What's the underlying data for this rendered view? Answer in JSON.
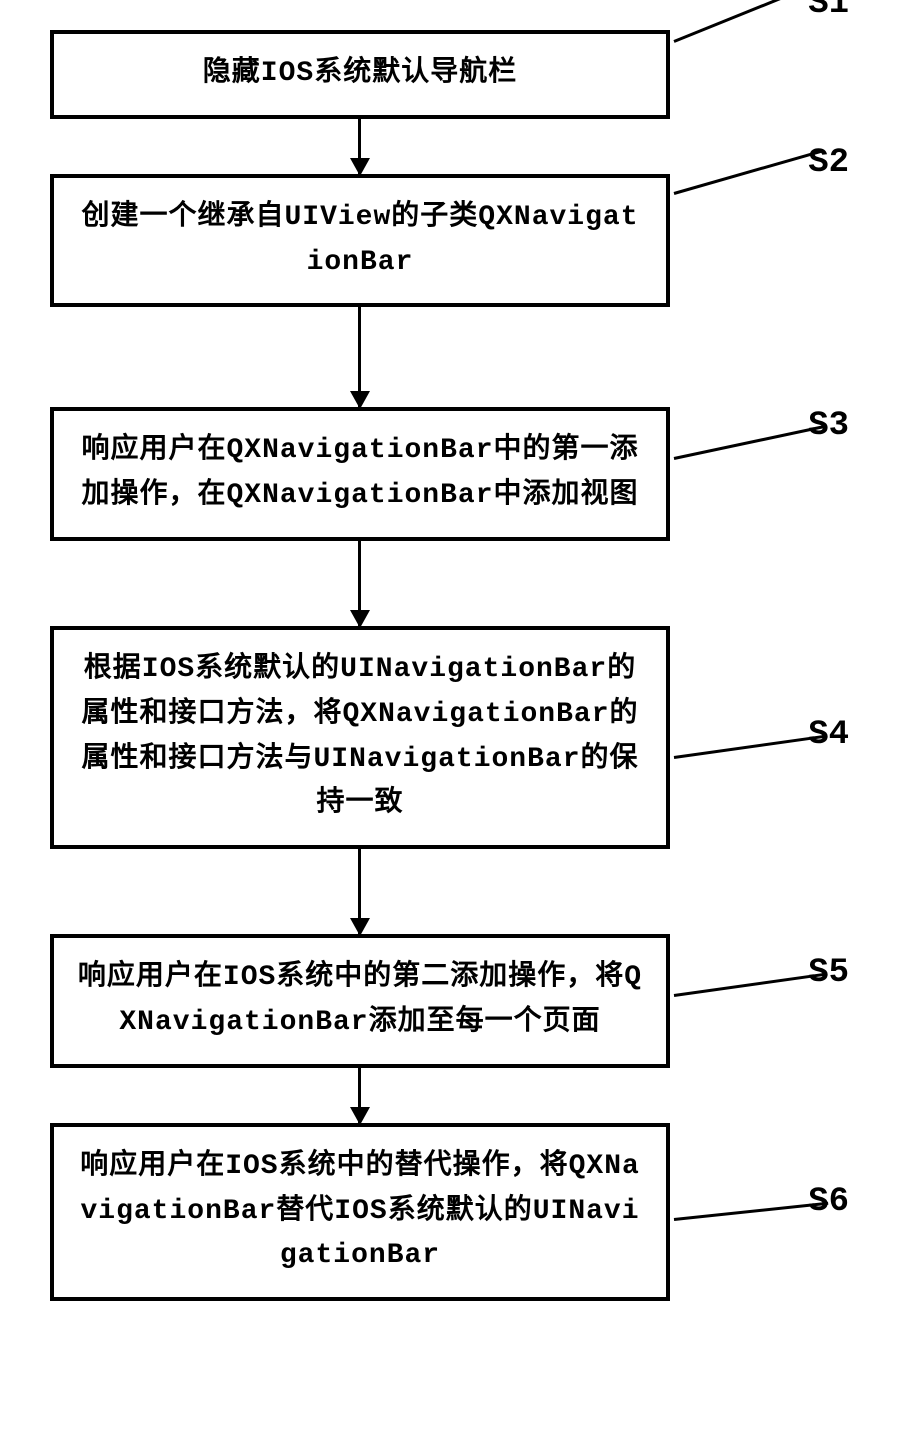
{
  "chart_data": {
    "type": "flowchart",
    "title": "",
    "steps": [
      {
        "id": "S1",
        "text": "隐藏IOS系统默认导航栏"
      },
      {
        "id": "S2",
        "text": "创建一个继承自UIView的子类QXNavigationBar"
      },
      {
        "id": "S3",
        "text": "响应用户在QXNavigationBar中的第一添加操作，在QXNavigationBar中添加视图"
      },
      {
        "id": "S4",
        "text": "根据IOS系统默认的UINavigationBar的属性和接口方法，将QXNavigationBar的属性和接口方法与UINavigationBar的保持一致"
      },
      {
        "id": "S5",
        "text": "响应用户在IOS系统中的第二添加操作，将QXNavigationBar添加至每一个页面"
      },
      {
        "id": "S6",
        "text": "响应用户在IOS系统中的替代操作，将QXNavigationBar替代IOS系统默认的UINavigationBar"
      }
    ]
  }
}
